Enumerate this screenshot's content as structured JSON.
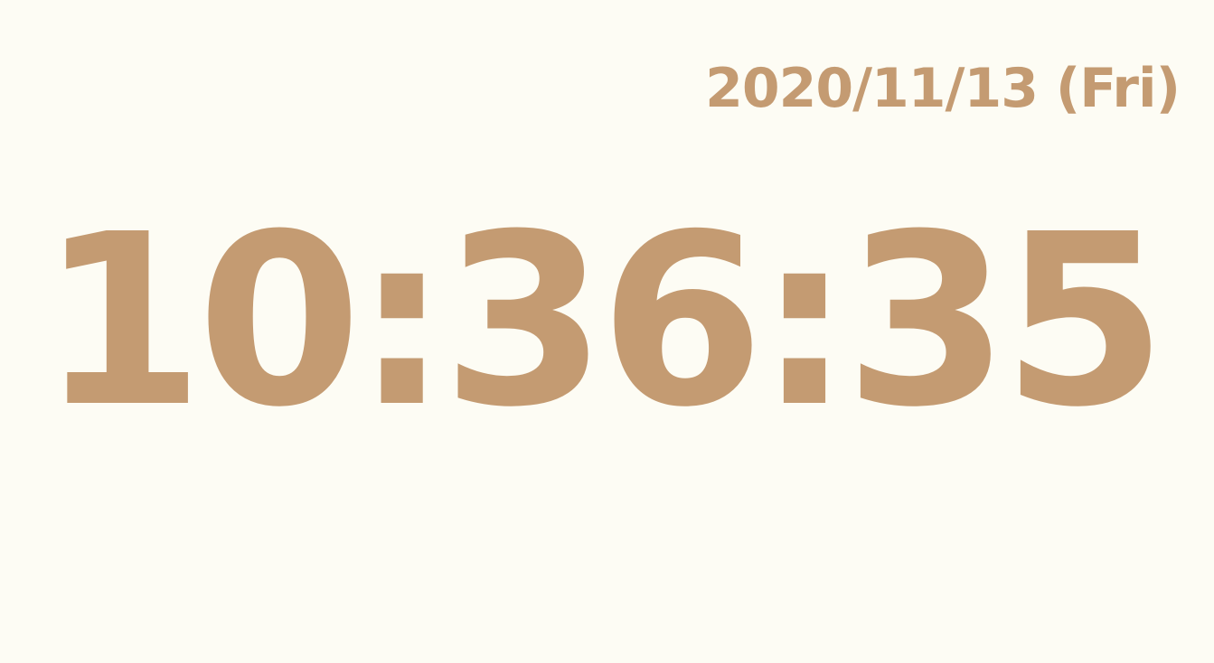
{
  "clock": {
    "date": "2020/11/13 (Fri)",
    "time": "10:36:35"
  },
  "colors": {
    "background": "#fdfcf4",
    "text": "#c49b72"
  }
}
